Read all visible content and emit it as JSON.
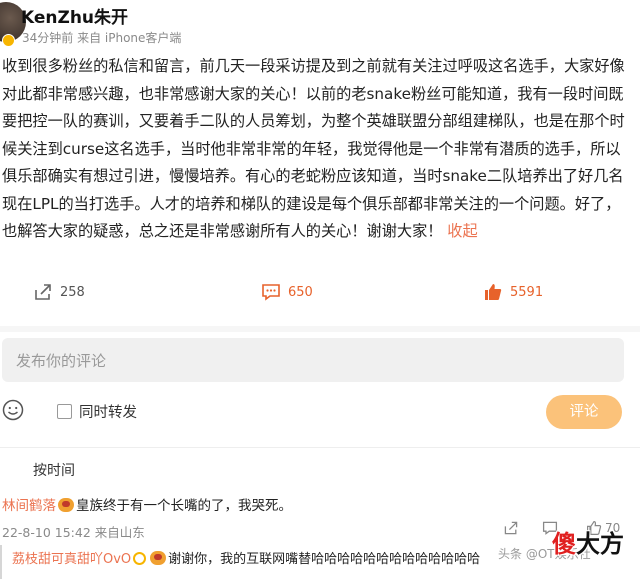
{
  "post": {
    "username": "KenZhu朱开",
    "meta": "34分钟前  来自 iPhone客户端",
    "content": "收到很多粉丝的私信和留言，前几天一段采访提及到之前就有关注过呼吸这名选手，大家好像对此都非常感兴趣，也非常感谢大家的关心！以前的老snake粉丝可能知道，我有一段时间既要把控一队的赛训，又要着手二队的人员筹划，为整个英雄联盟分部组建梯队，也是在那个时候关注到curse这名选手，当时他非常非常的年轻，我觉得他是一个非常有潜质的选手，所以俱乐部确实有想过引进，慢慢培养。有心的老蛇粉应该知道，当时snake二队培养出了好几名现在LPL的当打选手。人才的培养和梯队的建设是每个俱乐部都非常关注的一个问题。好了，也解答大家的疑惑，总之还是非常感谢所有人的关心！谢谢大家！",
    "collapse_label": "收起"
  },
  "actions": {
    "share_count": "258",
    "comment_count": "650",
    "like_count": "5591"
  },
  "comment_input": {
    "placeholder": "发布你的评论"
  },
  "toolbar": {
    "repost_label": "同时转发",
    "submit_label": "评论"
  },
  "sort": {
    "label": "按时间"
  },
  "comments": [
    {
      "name": "林间鹤落",
      "text": "皇族终于有一个长嘴的了，我哭死。",
      "meta": "22-8-10 15:42 来自山东",
      "likes": "70"
    }
  ],
  "reply": {
    "name": "荔枝甜可真甜吖OvO",
    "text": "谢谢你，我的互联网嘴替哈哈哈哈哈哈哈哈哈哈哈哈哈"
  },
  "watermark": {
    "handle": "头条 @OT娱乐社",
    "brand_red": "傻",
    "brand_black": "大方"
  },
  "colors": {
    "accent": "#e7622b",
    "name": "#eb7350",
    "submit_bg": "#fbc27a"
  }
}
